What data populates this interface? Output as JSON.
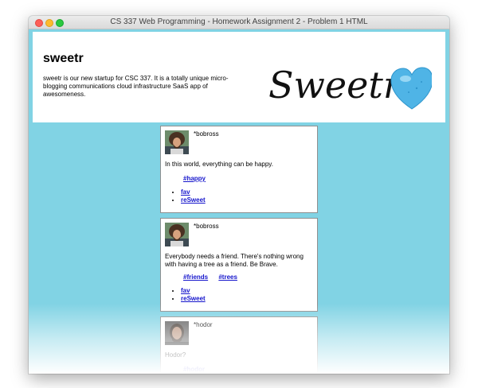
{
  "window": {
    "title": "CS 337 Web Programming - Homework Assignment 2 - Problem 1 HTML"
  },
  "header": {
    "title": "sweetr",
    "description": "sweetr is our new startup for CSC 337. It is a totally unique micro-blogging communications cloud infrastructure SaaS app of awesomeness.",
    "logo_text": "Sweetr"
  },
  "sweets": [
    {
      "handle": "*bobross",
      "text": "In this world, everything can be happy.",
      "tags": [
        "#happy"
      ],
      "actions": [
        "fav",
        "reSweet"
      ]
    },
    {
      "handle": "*bobross",
      "text": "Everybody needs a friend. There's nothing wrong with having a tree as a friend. Be Brave.",
      "tags": [
        "#friends",
        "#trees"
      ],
      "actions": [
        "fav",
        "reSweet"
      ]
    },
    {
      "handle": "*hodor",
      "text": "Hodor?",
      "tags": [
        "#hodor"
      ],
      "actions": []
    }
  ],
  "colors": {
    "page_bg": "#81d3e4",
    "link": "#1515cc",
    "heart": "#4fb4e6"
  }
}
